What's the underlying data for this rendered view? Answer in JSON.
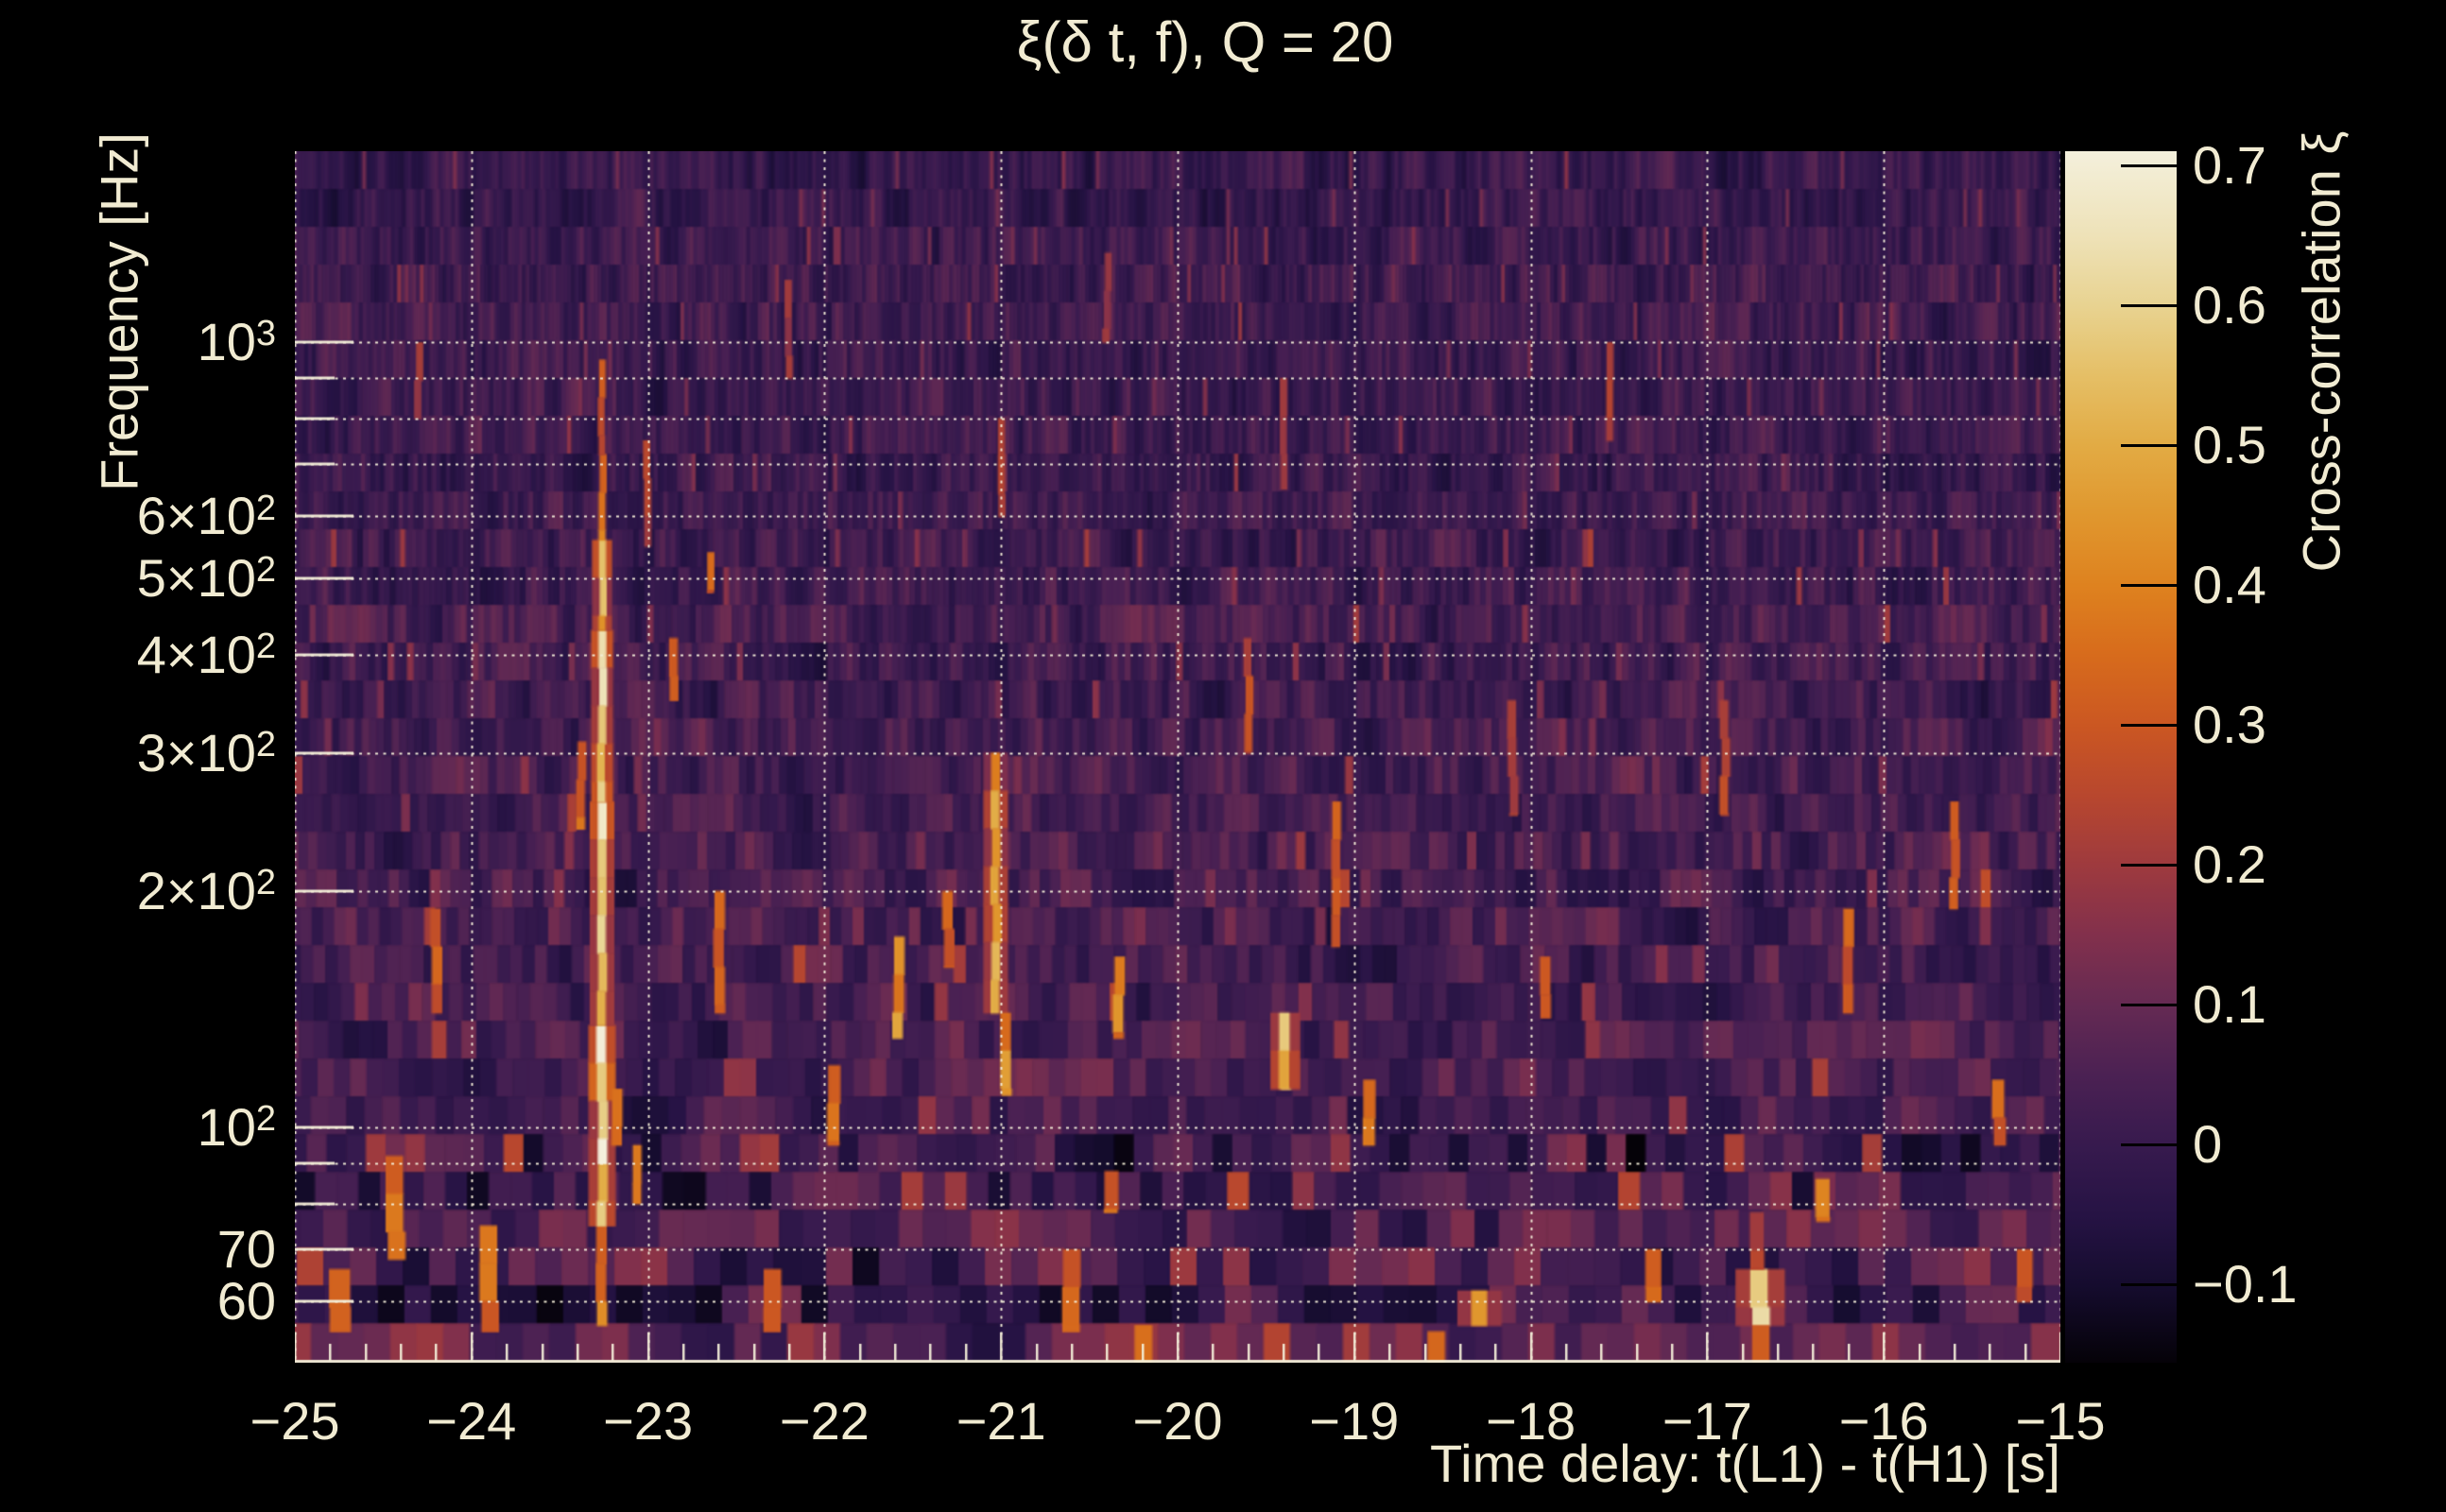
{
  "page": {
    "background": "#000000",
    "text_color": "#f1ebd2"
  },
  "chart_data": {
    "type": "heatmap",
    "title": "ξ(δ t, f), Q = 20",
    "xlabel": "Time delay: t(L1) - t(H1) [s]",
    "ylabel": "Frequency [Hz]",
    "colorbar_label": "Cross-correlation ξ",
    "x_axis": {
      "min": -25,
      "max": -15,
      "ticks": [
        {
          "value": -25,
          "label": "−25"
        },
        {
          "value": -24,
          "label": "−24"
        },
        {
          "value": -23,
          "label": "−23"
        },
        {
          "value": -22,
          "label": "−22"
        },
        {
          "value": -21,
          "label": "−21"
        },
        {
          "value": -20,
          "label": "−20"
        },
        {
          "value": -19,
          "label": "−19"
        },
        {
          "value": -18,
          "label": "−18"
        },
        {
          "value": -17,
          "label": "−17"
        },
        {
          "value": -16,
          "label": "−16"
        },
        {
          "value": -15,
          "label": "−15"
        }
      ],
      "minor_tick_step": 0.2,
      "gridlines": [
        -25,
        -24,
        -23,
        -22,
        -21,
        -20,
        -19,
        -18,
        -17,
        -16,
        -15
      ],
      "grid_style": "dotted"
    },
    "y_axis": {
      "scale": "log",
      "min": 50.4,
      "max": 1750,
      "tick_labels": [
        {
          "value": 1000,
          "text": "10",
          "sup": "3"
        },
        {
          "value": 600,
          "text": "6×10",
          "sup": "2"
        },
        {
          "value": 500,
          "text": "5×10",
          "sup": "2"
        },
        {
          "value": 400,
          "text": "4×10",
          "sup": "2"
        },
        {
          "value": 300,
          "text": "3×10",
          "sup": "2"
        },
        {
          "value": 200,
          "text": "2×10",
          "sup": "2"
        },
        {
          "value": 100,
          "text": "10",
          "sup": "2"
        },
        {
          "value": 70,
          "text": "70",
          "sup": ""
        },
        {
          "value": 60,
          "text": "60",
          "sup": ""
        }
      ],
      "gridline_freqs": [
        60,
        70,
        80,
        90,
        100,
        200,
        300,
        400,
        500,
        600,
        700,
        800,
        900,
        1000
      ],
      "labeled_freqs": [
        60,
        70,
        100,
        200,
        300,
        400,
        500,
        600,
        1000
      ],
      "grid_style": "dotted"
    },
    "z_axis": {
      "min": -0.155,
      "max": 0.71,
      "ticks": [
        {
          "value": 0.7,
          "label": "0.7"
        },
        {
          "value": 0.6,
          "label": "0.6"
        },
        {
          "value": 0.5,
          "label": "0.5"
        },
        {
          "value": 0.4,
          "label": "0.4"
        },
        {
          "value": 0.3,
          "label": "0.3"
        },
        {
          "value": 0.2,
          "label": "0.2"
        },
        {
          "value": 0.1,
          "label": "0.1"
        },
        {
          "value": 0,
          "label": "0"
        },
        {
          "value": -0.1,
          "label": "−0.1"
        }
      ]
    },
    "colormap": [
      [
        -0.155,
        "#050208"
      ],
      [
        -0.1,
        "#150c2e"
      ],
      [
        -0.05,
        "#261344"
      ],
      [
        0.0,
        "#371a4e"
      ],
      [
        0.05,
        "#4b2153"
      ],
      [
        0.1,
        "#652a53"
      ],
      [
        0.15,
        "#82304c"
      ],
      [
        0.2,
        "#9e3a3e"
      ],
      [
        0.25,
        "#b8472e"
      ],
      [
        0.3,
        "#cb5722"
      ],
      [
        0.35,
        "#d76b1c"
      ],
      [
        0.4,
        "#de821f"
      ],
      [
        0.45,
        "#e0972e"
      ],
      [
        0.5,
        "#e2ab44"
      ],
      [
        0.55,
        "#e5bf66"
      ],
      [
        0.6,
        "#e8d391"
      ],
      [
        0.65,
        "#eee2b8"
      ],
      [
        0.71,
        "#f4f0dc"
      ]
    ],
    "noise": {
      "seed": 1337,
      "rows": 32,
      "bands": [
        {
          "f_min": 600,
          "f_max": 1750,
          "mean": 0.012,
          "sd": 0.05,
          "p_bright": 0.02,
          "bright_max": 0.2
        },
        {
          "f_min": 250,
          "f_max": 600,
          "mean": 0.018,
          "sd": 0.055,
          "p_bright": 0.03,
          "bright_max": 0.24
        },
        {
          "f_min": 100,
          "f_max": 250,
          "mean": 0.028,
          "sd": 0.065,
          "p_bright": 0.05,
          "bright_max": 0.3
        },
        {
          "f_min": 50,
          "f_max": 100,
          "mean": 0.035,
          "sd": 0.09,
          "p_bright": 0.08,
          "bright_max": 0.36
        }
      ],
      "band_offsets": [
        {
          "f_min": 78,
          "f_max": 95,
          "delta": -0.045
        },
        {
          "f_min": 57,
          "f_max": 64,
          "delta": -0.045
        },
        {
          "f_min": 50,
          "f_max": 54,
          "delta": 0.05
        },
        {
          "f_min": 1200,
          "f_max": 1750,
          "delta": -0.008
        }
      ]
    },
    "features": [
      [
        -23.26,
        56,
        75,
        0.38,
        0.06
      ],
      [
        -23.26,
        75,
        90,
        0.5,
        0.055
      ],
      [
        -23.26,
        90,
        135,
        0.7,
        0.055
      ],
      [
        -23.26,
        135,
        260,
        0.62,
        0.05
      ],
      [
        -23.26,
        260,
        430,
        0.58,
        0.045
      ],
      [
        -23.26,
        430,
        560,
        0.52,
        0.04
      ],
      [
        -23.26,
        560,
        720,
        0.38,
        0.04
      ],
      [
        -23.26,
        720,
        950,
        0.27,
        0.038
      ],
      [
        -23.06,
        80,
        95,
        0.42,
        0.05
      ],
      [
        -23.38,
        240,
        310,
        0.33,
        0.05
      ],
      [
        -23.17,
        95,
        112,
        0.4,
        0.06
      ],
      [
        -23.9,
        55,
        75,
        0.33,
        0.1
      ],
      [
        -24.75,
        55,
        66,
        0.32,
        0.12
      ],
      [
        -24.43,
        68,
        92,
        0.38,
        0.1
      ],
      [
        -24.2,
        140,
        190,
        0.3,
        0.06
      ],
      [
        -24.3,
        800,
        1000,
        0.2,
        0.04
      ],
      [
        -22.86,
        350,
        420,
        0.33,
        0.05
      ],
      [
        -22.65,
        480,
        540,
        0.3,
        0.04
      ],
      [
        -22.6,
        140,
        200,
        0.35,
        0.06
      ],
      [
        -22.3,
        55,
        66,
        0.32,
        0.1
      ],
      [
        -22.2,
        900,
        1200,
        0.2,
        0.04
      ],
      [
        -21.95,
        95,
        120,
        0.32,
        0.07
      ],
      [
        -21.58,
        130,
        175,
        0.42,
        0.06
      ],
      [
        -21.3,
        160,
        200,
        0.3,
        0.06
      ],
      [
        -21.03,
        140,
        300,
        0.45,
        0.05
      ],
      [
        -21.0,
        600,
        800,
        0.22,
        0.04
      ],
      [
        -20.97,
        110,
        140,
        0.4,
        0.06
      ],
      [
        -20.6,
        55,
        70,
        0.3,
        0.1
      ],
      [
        -20.4,
        1000,
        1300,
        0.18,
        0.04
      ],
      [
        -20.38,
        78,
        88,
        0.33,
        0.08
      ],
      [
        -20.33,
        130,
        165,
        0.4,
        0.06
      ],
      [
        -20.19,
        50,
        56,
        0.35,
        0.1
      ],
      [
        -19.6,
        300,
        420,
        0.25,
        0.045
      ],
      [
        -19.4,
        650,
        900,
        0.22,
        0.04
      ],
      [
        -19.39,
        112,
        140,
        0.52,
        0.06
      ],
      [
        -19.1,
        170,
        260,
        0.33,
        0.05
      ],
      [
        -18.92,
        95,
        115,
        0.38,
        0.07
      ],
      [
        -18.53,
        50,
        55,
        0.4,
        0.1
      ],
      [
        -18.29,
        56,
        62,
        0.45,
        0.09
      ],
      [
        -18.1,
        250,
        350,
        0.24,
        0.05
      ],
      [
        -17.92,
        138,
        165,
        0.36,
        0.06
      ],
      [
        -17.55,
        750,
        1000,
        0.22,
        0.04
      ],
      [
        -17.3,
        60,
        70,
        0.3,
        0.09
      ],
      [
        -16.9,
        250,
        350,
        0.26,
        0.05
      ],
      [
        -16.7,
        56,
        66,
        0.66,
        0.1
      ],
      [
        -16.7,
        50,
        56,
        0.34,
        0.1
      ],
      [
        -16.72,
        66,
        78,
        0.24,
        0.08
      ],
      [
        -16.35,
        76,
        86,
        0.36,
        0.08
      ],
      [
        -16.2,
        140,
        190,
        0.3,
        0.06
      ],
      [
        -15.6,
        190,
        260,
        0.3,
        0.05
      ],
      [
        -15.35,
        95,
        115,
        0.32,
        0.07
      ],
      [
        -15.2,
        60,
        70,
        0.3,
        0.09
      ],
      [
        -23.0,
        550,
        750,
        0.22,
        0.04
      ]
    ]
  }
}
